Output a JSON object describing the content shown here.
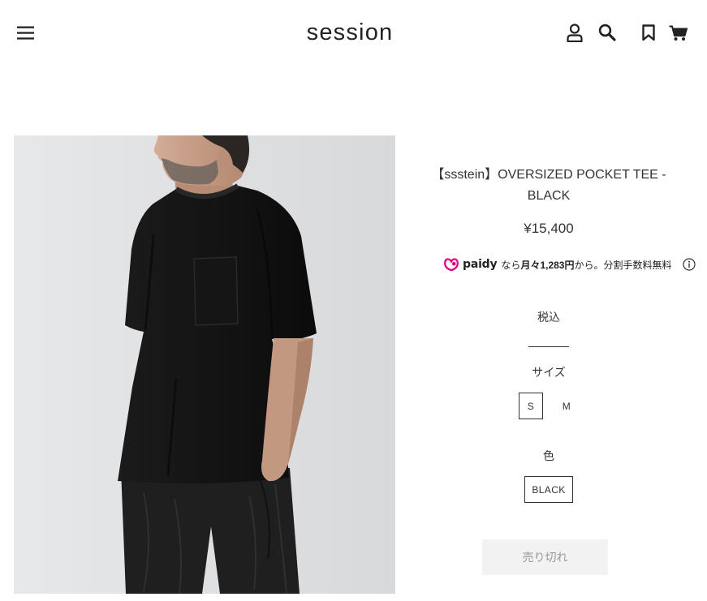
{
  "header": {
    "logo": "session",
    "icons": {
      "menu": "hamburger-menu-icon",
      "account": "user-icon",
      "search": "search-icon",
      "wishlist": "bookmark-icon",
      "cart": "cart-icon"
    }
  },
  "product": {
    "title": "【ssstein】OVERSIZED POCKET TEE - BLACK",
    "price": "¥15,400",
    "tax_note": "税込",
    "size_label": "サイズ",
    "sizes": [
      {
        "label": "S",
        "selected": true
      },
      {
        "label": "M",
        "selected": false
      }
    ],
    "color_label": "色",
    "colors": [
      {
        "label": "BLACK",
        "selected": true
      }
    ],
    "sold_out_label": "売り切れ"
  },
  "paidy": {
    "logo_text": "paidy",
    "text_prefix": "なら",
    "amount": "月々1,283円",
    "text_suffix": "から。分割手数料無料",
    "icon": "info-icon"
  },
  "theme": {
    "text": "#333333",
    "icon": "#222222",
    "paidy": "#e5007f",
    "soldout_bg": "#f2f2f2",
    "soldout_text": "#999999"
  }
}
